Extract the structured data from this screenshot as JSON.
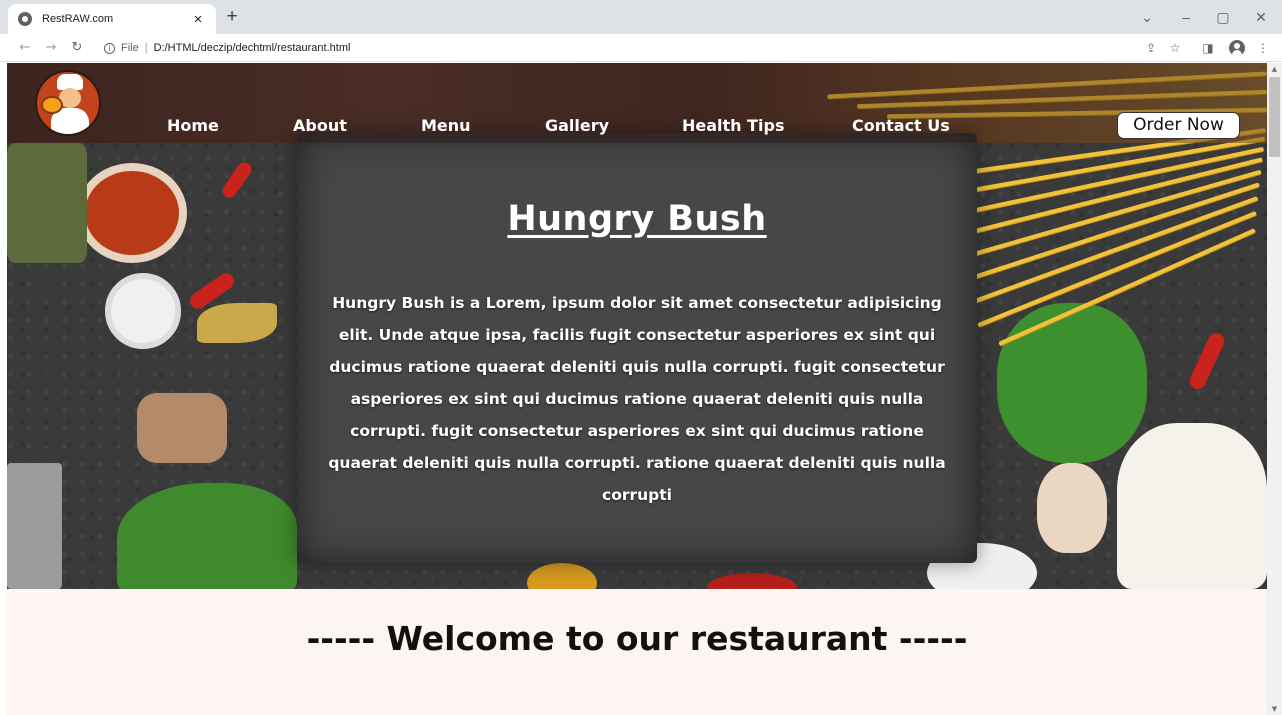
{
  "browser": {
    "tab_title": "RestRAW.com",
    "tab_close": "×",
    "new_tab": "+",
    "address_scheme": "File",
    "address_sep": "|",
    "address_url": "D:/HTML/deczip/dechtml/restaurant.html",
    "window_controls": [
      "⌄",
      "–",
      "▢",
      "✕"
    ]
  },
  "nav": {
    "links": [
      "Home",
      "About",
      "Menu",
      "Gallery",
      "Health Tips",
      "Contact Us"
    ],
    "order_button": "Order Now"
  },
  "hero": {
    "title": "Hungry  Bush",
    "text": "Hungry Bush is a Lorem, ipsum dolor sit amet consectetur adipisicing elit. Unde atque ipsa, facilis fugit consectetur asperiores ex sint qui ducimus ratione quaerat deleniti quis nulla corrupti. fugit consectetur asperiores ex sint qui ducimus ratione quaerat deleniti quis nulla corrupti. fugit consectetur asperiores ex sint qui ducimus ratione quaerat deleniti quis nulla corrupti. ratione quaerat deleniti quis nulla corrupti"
  },
  "welcome": {
    "title": "----- Welcome to our restaurant -----"
  },
  "colors": {
    "accent_pasta": "#f3c23b",
    "welcome_bg": "#fdf5f1",
    "slate": "#474747"
  }
}
